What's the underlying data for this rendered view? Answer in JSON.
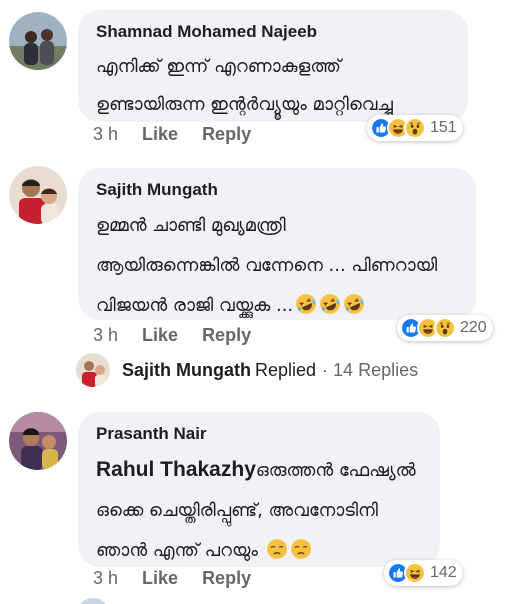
{
  "comments": [
    {
      "name": "Shamnad Mohamed Najeeb",
      "text_lines": [
        "എനിക്ക് ഇന്ന് എറണാകുളത്ത്",
        "ഉണ്ടായിരുന്ന ഇന്റർവ്യൂയും മാറ്റിവെച്ചു"
      ],
      "time": "3 h",
      "like_label": "Like",
      "reply_label": "Reply",
      "reactions": [
        "like-icon",
        "haha-icon",
        "wow-icon"
      ],
      "reaction_count": "151"
    },
    {
      "name": "Sajith Mungath",
      "text_lines": [
        "ഉമ്മൻ ചാണ്ടി മുഖ്യമന്ത്രി",
        "ആയിരുന്നെങ്കിൽ വന്നേനെ ... പിണറായി",
        "വിജയൻ രാജി വയ്ക്കുക ..."
      ],
      "trailing_emojis": [
        "rofl-icon",
        "rofl-icon",
        "rofl-icon"
      ],
      "time": "3 h",
      "like_label": "Like",
      "reply_label": "Reply",
      "reactions": [
        "like-icon",
        "haha-icon",
        "wow-icon"
      ],
      "reaction_count": "220",
      "replies_summary": {
        "name": "Sajith Mungath",
        "verb": "Replied",
        "count": "· 14 Replies"
      }
    },
    {
      "name": "Prasanth Nair",
      "mention": "Rahul Thakazhy",
      "text_lines": [
        "ഒരുത്തൻ ഫേഷ്യൽ",
        "ഒക്കെ ചെയ്തിരിപ്പുണ്ട്, അവനോടിനി",
        "ഞാൻ എന്ത് പറയും"
      ],
      "trailing_emojis": [
        "unamused-icon",
        "unamused-icon"
      ],
      "time": "3 h",
      "like_label": "Like",
      "reply_label": "Reply",
      "reactions": [
        "like-icon",
        "haha-icon"
      ],
      "reaction_count": "142"
    }
  ],
  "colors": {
    "bubble": "#f0f2f5",
    "like_blue": "#1877f2",
    "emoji_yellow": "#f7c23f",
    "meta_gray": "#65676b"
  }
}
